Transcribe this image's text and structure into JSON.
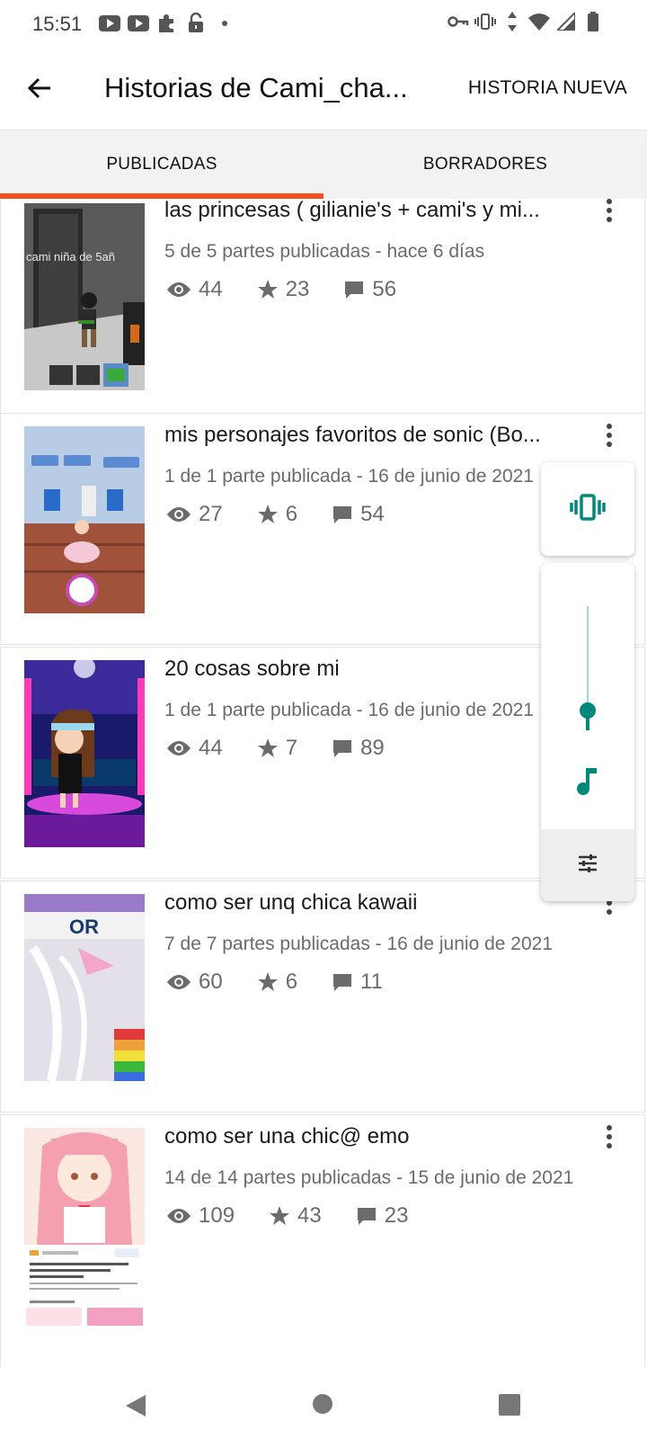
{
  "status_bar": {
    "time": "15:51",
    "left_icons": [
      "youtube-icon",
      "youtube-icon",
      "puzzle-icon",
      "unlock-icon",
      "dot-icon"
    ],
    "right_icons": [
      "key-icon",
      "vibrate-icon",
      "data-arrows-icon",
      "wifi-icon",
      "signal-icon",
      "battery-icon"
    ]
  },
  "app_bar": {
    "back_icon": "arrow-back-icon",
    "title": "Historias de Cami_cha...",
    "action_label": "HISTORIA NUEVA"
  },
  "tabs": [
    {
      "label": "PUBLICADAS",
      "selected": true
    },
    {
      "label": "BORRADORES",
      "selected": false
    }
  ],
  "accent_color": "#f4511e",
  "stories": [
    {
      "title": "las princesas ( gilianie's + cami's y mi...",
      "meta": "5 de 5 partes publicadas - hace 6 días",
      "views": "44",
      "votes": "23",
      "comments": "56",
      "thumb_text": "cami niña de 5añ"
    },
    {
      "title": "mis personajes favoritos de sonic (Bo...",
      "meta": "1 de 1 parte publicada - 16 de junio de 2021",
      "views": "27",
      "votes": "6",
      "comments": "54"
    },
    {
      "title": "20 cosas sobre mi",
      "meta": "1 de 1 parte publicada - 16 de junio de 2021",
      "views": "44",
      "votes": "7",
      "comments": "89"
    },
    {
      "title": "como ser unq chica kawaii",
      "meta": "7 de 7 partes publicadas - 16 de junio de 2021",
      "views": "60",
      "votes": "6",
      "comments": "11",
      "thumb_text": "OR"
    },
    {
      "title": "como ser una chic@ emo",
      "meta": "14 de 14 partes publicadas - 15 de junio de 2021",
      "views": "109",
      "votes": "43",
      "comments": "23"
    }
  ],
  "volume_panel": {
    "ring_mode_icon": "vibrate-icon",
    "level": 0.16,
    "stream_icon": "music-note-icon",
    "settings_icon": "tune-icon",
    "accent": "#00897b"
  },
  "nav_bar": {
    "icons": [
      "nav-back-icon",
      "nav-home-icon",
      "nav-recent-icon"
    ]
  }
}
